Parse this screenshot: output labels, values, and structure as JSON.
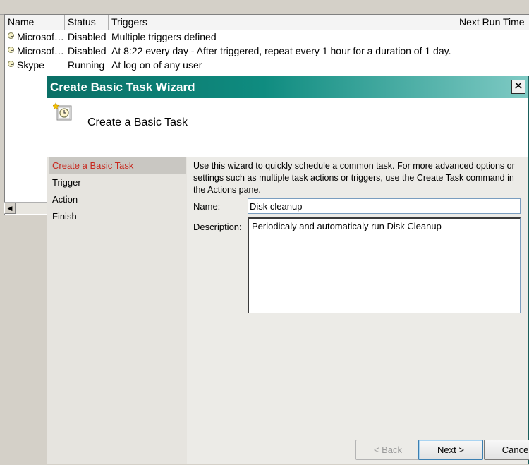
{
  "task_list": {
    "columns": {
      "name": "Name",
      "status": "Status",
      "triggers": "Triggers",
      "next_run_time": "Next Run Time"
    },
    "rows": [
      {
        "name": "Microsof…",
        "status": "Disabled",
        "triggers": "Multiple triggers defined",
        "icon": "clock-icon"
      },
      {
        "name": "Microsof…",
        "status": "Disabled",
        "triggers": "At 8:22 every day - After triggered, repeat every 1 hour for a duration of 1 day.",
        "icon": "clock-icon"
      },
      {
        "name": "Skype",
        "status": "Running",
        "triggers": "At log on of any user",
        "icon": "clock-icon"
      }
    ],
    "scroll_left_glyph": "◀"
  },
  "wizard": {
    "title": "Create Basic Task Wizard",
    "close_glyph": "✕",
    "header_title": "Create a Basic Task",
    "steps": [
      {
        "label": "Create a Basic Task",
        "active": true
      },
      {
        "label": "Trigger",
        "active": false
      },
      {
        "label": "Action",
        "active": false
      },
      {
        "label": "Finish",
        "active": false
      }
    ],
    "intro": "Use this wizard to quickly schedule a common task.  For more advanced options or settings such as multiple task actions or triggers, use the Create Task command in the Actions pane.",
    "name_label": "Name:",
    "name_value": "Disk cleanup",
    "description_label": "Description:",
    "description_value": "Periodicaly and automaticaly run Disk Cleanup",
    "buttons": {
      "back": "< Back",
      "next": "Next >",
      "cancel": "Cancel"
    },
    "colors": {
      "titlebar": "#0a6f66",
      "active_step": "#c8281e"
    }
  }
}
